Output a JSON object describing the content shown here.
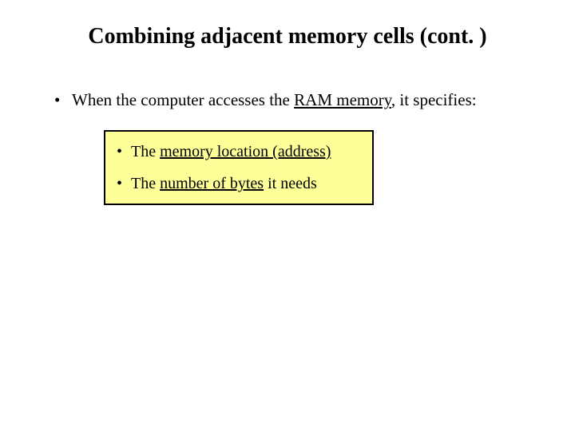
{
  "title": "Combining adjacent memory cells (cont. )",
  "bullet": {
    "pre": "When the computer accesses the ",
    "ram": "RAM memory",
    "post": ", it specifies:"
  },
  "box": {
    "line1": {
      "pre": "The ",
      "u": "memory location (address)"
    },
    "line2": {
      "pre": "The ",
      "u": "number of bytes",
      "post": " it needs"
    }
  }
}
